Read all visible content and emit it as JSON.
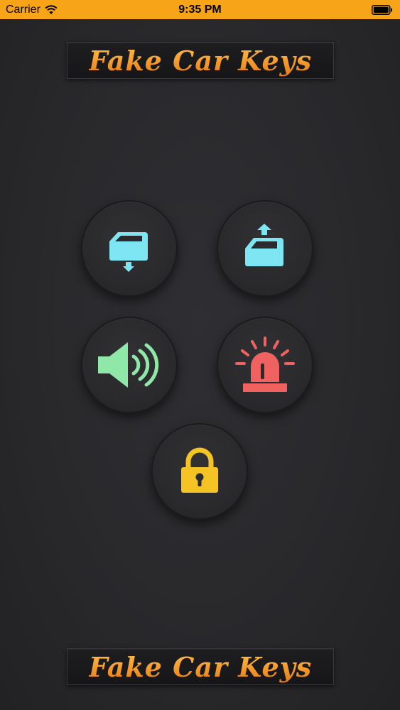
{
  "status_bar": {
    "carrier": "Carrier",
    "time": "9:35 PM",
    "icons": [
      "wifi-icon",
      "battery-icon"
    ]
  },
  "header": {
    "title": "Fake Car Keys"
  },
  "footer": {
    "title": "Fake Car Keys"
  },
  "buttons": [
    {
      "icon": "window-down-icon",
      "color": "#7ee6f2"
    },
    {
      "icon": "window-up-icon",
      "color": "#7ee6f2"
    },
    {
      "icon": "speaker-icon",
      "color": "#8fe7a8"
    },
    {
      "icon": "siren-icon",
      "color": "#f0625f"
    },
    {
      "icon": "lock-icon",
      "color": "#f5c424"
    }
  ],
  "colors": {
    "status_bar_bg": "#f7a418",
    "title_orange": "#f6a030"
  }
}
